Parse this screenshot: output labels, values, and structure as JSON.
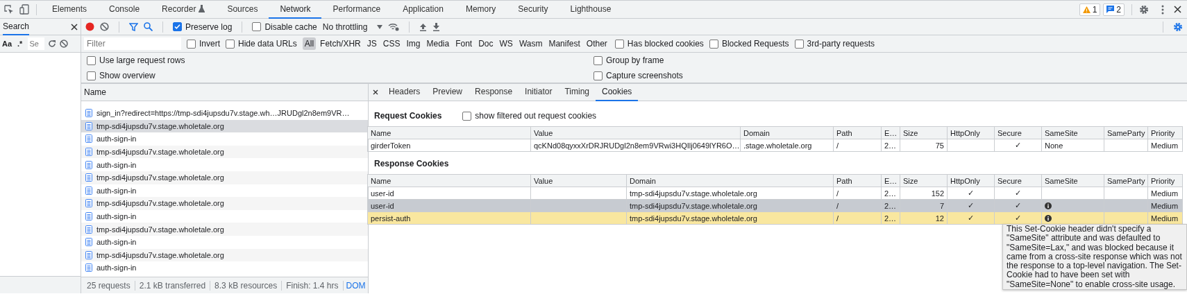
{
  "main_tabs": [
    {
      "label": "Elements",
      "selected": false,
      "kind": "plain"
    },
    {
      "label": "Console",
      "selected": false,
      "kind": "plain"
    },
    {
      "label": "Recorder",
      "selected": false,
      "kind": "experiment"
    },
    {
      "label": "Sources",
      "selected": false,
      "kind": "plain"
    },
    {
      "label": "Network",
      "selected": true,
      "kind": "plain"
    },
    {
      "label": "Performance",
      "selected": false,
      "kind": "plain"
    },
    {
      "label": "Application",
      "selected": false,
      "kind": "plain"
    },
    {
      "label": "Memory",
      "selected": false,
      "kind": "plain"
    },
    {
      "label": "Security",
      "selected": false,
      "kind": "plain"
    },
    {
      "label": "Lighthouse",
      "selected": false,
      "kind": "plain"
    }
  ],
  "issue_badges": [
    {
      "kind": "warning",
      "count": "1"
    },
    {
      "kind": "message",
      "count": "2"
    }
  ],
  "search_panel": {
    "title": "Search",
    "case_label": "Aa",
    "regex_label": ".*",
    "placeholder": "Se"
  },
  "toolbar": {
    "recording": true,
    "preserve_log": {
      "label": "Preserve log",
      "checked": true
    },
    "disable_cache": {
      "label": "Disable cache",
      "checked": false
    },
    "throttling": "No throttling"
  },
  "filter_bar": {
    "placeholder": "Filter",
    "invert": {
      "label": "Invert",
      "checked": false
    },
    "hide_data_urls": {
      "label": "Hide data URLs",
      "checked": false
    },
    "types": [
      {
        "label": "All",
        "selected": true
      },
      {
        "label": "Fetch/XHR",
        "selected": false
      },
      {
        "label": "JS",
        "selected": false
      },
      {
        "label": "CSS",
        "selected": false
      },
      {
        "label": "Img",
        "selected": false
      },
      {
        "label": "Media",
        "selected": false
      },
      {
        "label": "Font",
        "selected": false
      },
      {
        "label": "Doc",
        "selected": false
      },
      {
        "label": "WS",
        "selected": false
      },
      {
        "label": "Wasm",
        "selected": false
      },
      {
        "label": "Manifest",
        "selected": false
      },
      {
        "label": "Other",
        "selected": false
      }
    ],
    "options": [
      {
        "label": "Has blocked cookies",
        "checked": false
      },
      {
        "label": "Blocked Requests",
        "checked": false
      },
      {
        "label": "3rd-party requests",
        "checked": false
      }
    ]
  },
  "settings": [
    {
      "label": "Use large request rows",
      "checked": false
    },
    {
      "label": "Group by frame",
      "checked": false
    },
    {
      "label": "Show overview",
      "checked": false
    },
    {
      "label": "Capture screenshots",
      "checked": false
    }
  ],
  "request_list": {
    "column": "Name",
    "rows": [
      {
        "name": "sign_in?redirect=https://tmp-sdi4jupsdu7v.stage.wh…JRUDgl2n8em9VR…",
        "selected": false
      },
      {
        "name": "tmp-sdi4jupsdu7v.stage.wholetale.org",
        "selected": true
      },
      {
        "name": "auth-sign-in",
        "selected": false
      },
      {
        "name": "tmp-sdi4jupsdu7v.stage.wholetale.org",
        "selected": false
      },
      {
        "name": "auth-sign-in",
        "selected": false
      },
      {
        "name": "tmp-sdi4jupsdu7v.stage.wholetale.org",
        "selected": false
      },
      {
        "name": "auth-sign-in",
        "selected": false
      },
      {
        "name": "tmp-sdi4jupsdu7v.stage.wholetale.org",
        "selected": false
      },
      {
        "name": "auth-sign-in",
        "selected": false
      },
      {
        "name": "tmp-sdi4jupsdu7v.stage.wholetale.org",
        "selected": false
      },
      {
        "name": "auth-sign-in",
        "selected": false
      },
      {
        "name": "tmp-sdi4jupsdu7v.stage.wholetale.org",
        "selected": false
      },
      {
        "name": "auth-sign-in",
        "selected": false
      }
    ]
  },
  "status_bar": [
    {
      "text": "25 requests",
      "kind": "stat"
    },
    {
      "text": "2.1 kB transferred",
      "kind": "stat"
    },
    {
      "text": "8.3 kB resources",
      "kind": "stat"
    },
    {
      "text": "Finish: 1.4 hrs",
      "kind": "stat"
    },
    {
      "text": "DOM",
      "kind": "link"
    }
  ],
  "detail": {
    "tabs": [
      {
        "label": "Headers",
        "selected": false
      },
      {
        "label": "Preview",
        "selected": false
      },
      {
        "label": "Response",
        "selected": false
      },
      {
        "label": "Initiator",
        "selected": false
      },
      {
        "label": "Timing",
        "selected": false
      },
      {
        "label": "Cookies",
        "selected": true
      }
    ],
    "request_cookies": {
      "title": "Request Cookies",
      "show_filtered": {
        "label": "show filtered out request cookies",
        "checked": false
      },
      "columns": [
        "Name",
        "Value",
        "Domain",
        "Path",
        "E…",
        "Size",
        "HttpOnly",
        "Secure",
        "SameSite",
        "SameParty",
        "Priority"
      ],
      "rows": [
        {
          "name": "girderToken",
          "value": "qcKNd08qyxxXrDRJRUDgl2n8em9VRwi3HQIlj0649lYR6O…",
          "domain": ".stage.wholetale.org",
          "path": "/",
          "expires": "2…",
          "size": "75",
          "secure": "✓",
          "same_site": "None",
          "priority": "Medium",
          "selected": false,
          "blocked": false
        }
      ]
    },
    "response_cookies": {
      "title": "Response Cookies",
      "columns": [
        "Name",
        "Value",
        "Domain",
        "Path",
        "E…",
        "Size",
        "HttpOnly",
        "Secure",
        "SameSite",
        "SameParty",
        "Priority"
      ],
      "rows": [
        {
          "name": "user-id",
          "domain": "tmp-sdi4jupsdu7v.stage.wholetale.org",
          "path": "/",
          "expires": "2…",
          "size": "152",
          "http_only": "✓",
          "secure": "✓",
          "priority": "Medium",
          "selected": false,
          "blocked": false
        },
        {
          "name": "user-id",
          "domain": "tmp-sdi4jupsdu7v.stage.wholetale.org",
          "path": "/",
          "expires": "2…",
          "size": "7",
          "http_only": "✓",
          "secure": "✓",
          "priority": "Medium",
          "selected": true,
          "blocked": true
        },
        {
          "name": "persist-auth",
          "domain": "tmp-sdi4jupsdu7v.stage.wholetale.org",
          "path": "/",
          "expires": "2…",
          "size": "12",
          "http_only": "✓",
          "secure": "✓",
          "priority": "Medium",
          "selected": false,
          "blocked": true
        }
      ]
    },
    "tooltip": "This Set-Cookie header didn't specify a \"SameSite\" attribute and was defaulted to \"SameSite=Lax,\" and was blocked because it came from a cross-site response which was not the response to a top-level navigation. The Set-Cookie had to have been set with \"SameSite=None\" to enable cross-site usage."
  }
}
